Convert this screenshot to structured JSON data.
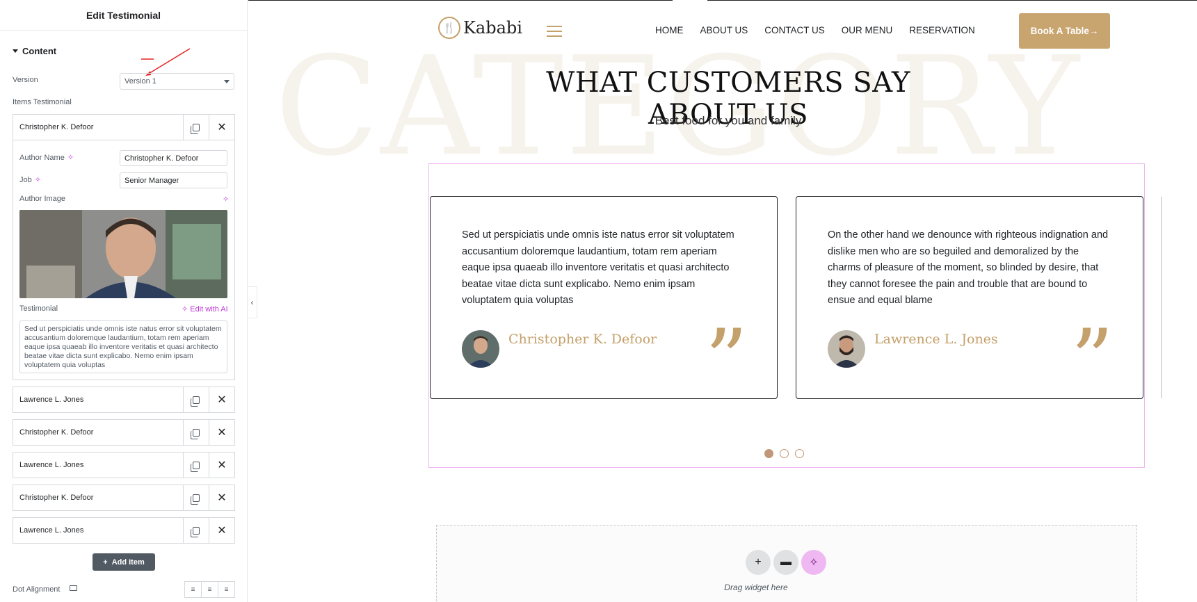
{
  "panel": {
    "title": "Edit Testimonial",
    "section_title": "Content",
    "version_label": "Version",
    "version_value": "Version 1",
    "items_label": "Items Testimonial",
    "open_item": {
      "title": "Christopher K. Defoor",
      "author_name_label": "Author Name",
      "author_name_value": "Christopher K. Defoor",
      "job_label": "Job",
      "job_value": "Senior Manager",
      "author_image_label": "Author Image",
      "testimonial_label": "Testimonial",
      "edit_with_ai": "Edit with AI",
      "testimonial_value": "Sed ut perspiciatis unde omnis iste natus error sit voluptatem accusantium doloremque laudantium, totam rem aperiam eaque ipsa quaeab illo inventore veritatis et quasi architecto beatae vitae dicta sunt explicabo. Nemo enim ipsam voluptatem quia voluptas"
    },
    "items": [
      {
        "title": "Lawrence L. Jones"
      },
      {
        "title": "Christopher K. Defoor"
      },
      {
        "title": "Lawrence L. Jones"
      },
      {
        "title": "Christopher K. Defoor"
      },
      {
        "title": "Lawrence L. Jones"
      }
    ],
    "add_item_label": "Add Item",
    "dot_alignment_label": "Dot Alignment"
  },
  "site": {
    "logo_text": "Kababi",
    "nav": [
      "HOME",
      "ABOUT US",
      "CONTACT US",
      "OUR MENU",
      "RESERVATION"
    ],
    "cta": "Book A Table",
    "watermark": "CATEGORY",
    "heading": "WHAT CUSTOMERS SAY ABOUT US",
    "subheading": "Best food for you and family",
    "cards": [
      {
        "text": "Sed ut perspiciatis unde omnis iste natus error sit voluptatem accusantium doloremque laudantium, totam rem aperiam eaque ipsa quaeab illo inventore veritatis et quasi architecto beatae vitae dicta sunt explicabo. Nemo enim ipsam voluptatem quia voluptas",
        "author": "Christopher K. Defoor"
      },
      {
        "text": "On the other hand we denounce with righteous indignation and dislike men who are so beguiled and demoralized by the charms of pleasure of the moment, so blinded by desire, that they cannot foresee the pain and trouble that are bound to ensue and equal blame",
        "author": "Lawrence L. Jones"
      }
    ],
    "drop_zone_text": "Drag widget here"
  },
  "colors": {
    "accent_gold": "#c8a46e",
    "ai_pink": "#f0b8f2",
    "dot_brown": "#c09778"
  },
  "icons": {
    "copy": "copy-icon",
    "remove": "close-icon",
    "add": "plus-icon",
    "folder": "folder-icon",
    "ai": "sparkle-icon"
  }
}
